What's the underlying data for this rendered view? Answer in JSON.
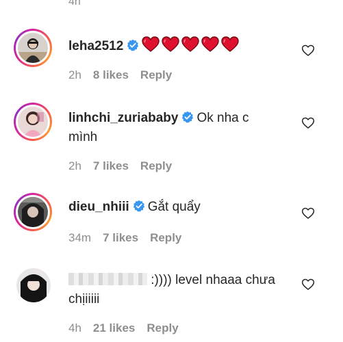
{
  "previous_comment": {
    "time": "4h"
  },
  "comments": [
    {
      "username": "leha2512",
      "text_hearts": 5,
      "time": "2h",
      "likes": "8 likes",
      "reply": "Reply"
    },
    {
      "username": "linhchi_zuriababy",
      "text": "Ok nha c",
      "text_line2": "mình",
      "time": "2h",
      "likes": "7 likes",
      "reply": "Reply"
    },
    {
      "username": "dieu_nhiii",
      "text": "Gắt quẩy",
      "time": "34m",
      "likes": "7 likes",
      "reply": "Reply"
    },
    {
      "text": ":)))) level nhaaa chưa",
      "text_line2": "chịiiiii",
      "time": "4h",
      "likes": "21 likes",
      "reply": "Reply"
    }
  ],
  "colors": {
    "verified": "#3897f0",
    "heart_emoji": "#e0102f",
    "meta_gray": "#8e8e8e"
  },
  "icons": {
    "verified": "verified-badge-icon",
    "like": "heart-outline-icon",
    "emoji": "red-heart-emoji-icon"
  }
}
